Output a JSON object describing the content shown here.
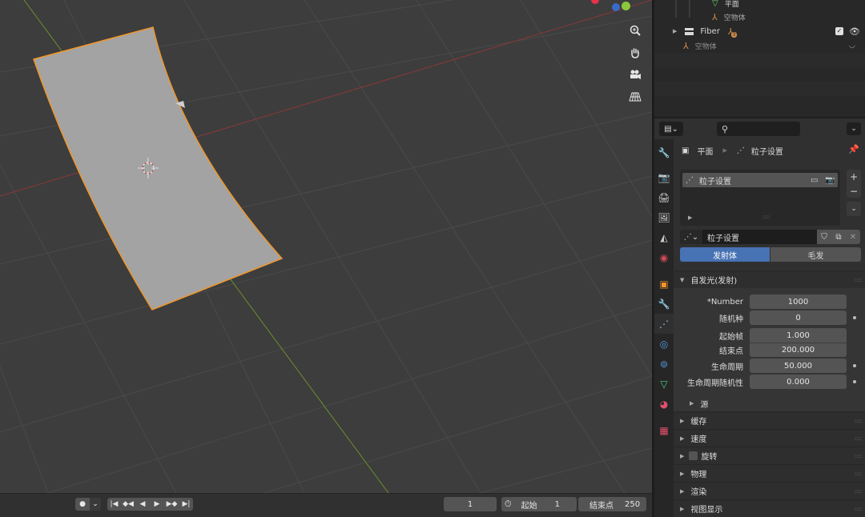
{
  "outliner": {
    "rows": [
      {
        "label": "平面",
        "kind": "mesh-data"
      },
      {
        "label": "空物体",
        "kind": "empty"
      },
      {
        "label": "Fiber",
        "kind": "collection",
        "badge": "3"
      },
      {
        "label": "空物体",
        "kind": "empty"
      }
    ]
  },
  "properties": {
    "breadcrumb": {
      "object": "平面",
      "data": "粒子设置"
    },
    "particle_list": {
      "item": "粒子设置"
    },
    "settings_name": "粒子设置",
    "type_tabs": {
      "emitter": "发射体",
      "hair": "毛发",
      "active": "emitter"
    },
    "emission": {
      "header": "自发光(发射)",
      "fields": [
        {
          "label": "*Number",
          "value": "1000"
        },
        {
          "label": "随机种",
          "value": "0"
        },
        {
          "label": "起始帧",
          "value": "1.000"
        },
        {
          "label": "结束点",
          "value": "200.000"
        },
        {
          "label": "生命周期",
          "value": "50.000"
        },
        {
          "label": "生命周期随机性",
          "value": "0.000"
        }
      ],
      "source": "源"
    },
    "panels": [
      "缓存",
      "速度",
      "旋转",
      "物理",
      "渲染",
      "视图显示"
    ]
  },
  "timeline": {
    "current_frame": "1",
    "start_label": "起始",
    "start_value": "1",
    "end_label": "结束点",
    "end_value": "250"
  },
  "colors": {
    "accent": "#4772b3",
    "selection_outline": "#f0962a",
    "x_axis": "#a83a3a",
    "y_axis": "#6c8f2a",
    "panel_bg": "#303030",
    "viewport_bg": "#3d3d3d"
  }
}
